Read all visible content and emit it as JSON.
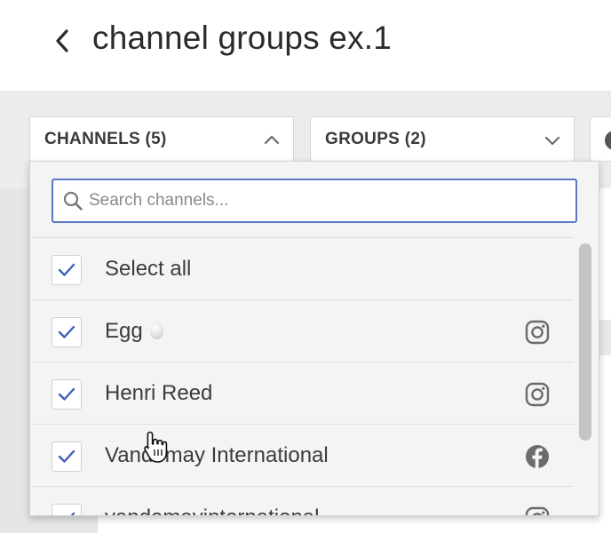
{
  "header": {
    "title": "channel groups ex.1",
    "back_icon": "chevron-left-icon"
  },
  "filters": {
    "channels_label": "CHANNELS (5)",
    "channels_icon": "chevron-up-icon",
    "groups_label": "GROUPS (2)",
    "groups_icon": "chevron-down-icon"
  },
  "dropdown": {
    "search_placeholder": "Search channels...",
    "search_icon": "search-icon",
    "items": [
      {
        "label": "Select all",
        "checked": true
      },
      {
        "label": "Egg",
        "checked": true,
        "network": "instagram-icon"
      },
      {
        "label": "Henri Reed",
        "checked": true,
        "network": "instagram-icon"
      },
      {
        "label": "Vandemay International",
        "checked": true,
        "network": "facebook-icon"
      },
      {
        "label": "vandemayinternational",
        "checked": true,
        "network": "instagram-icon"
      }
    ]
  },
  "colors": {
    "accent": "#5b78c6",
    "check": "#3f5fb8",
    "icon_gray": "#6b6b6b"
  }
}
